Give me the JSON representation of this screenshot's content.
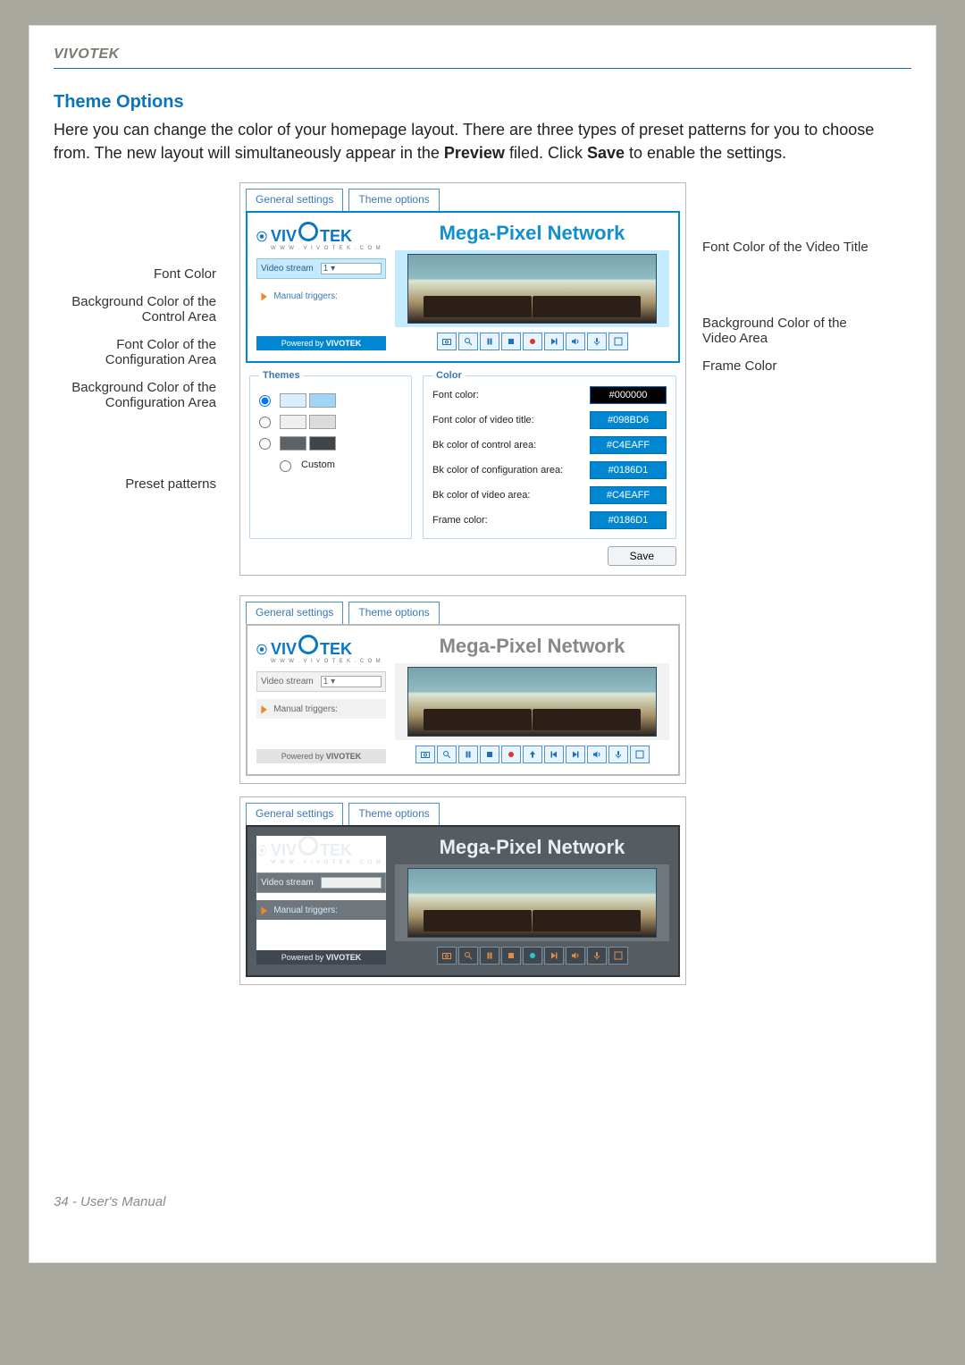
{
  "brand": "VIVOTEK",
  "section_title": "Theme Options",
  "intro_parts": {
    "a": "Here you can change the color of your homepage layout. There are three types of preset patterns for you to choose from. The new layout will simultaneously appear in the ",
    "b": "Preview",
    "c": " filed. Click ",
    "d": "Save",
    "e": " to enable the settings."
  },
  "callouts_left": [
    "Font Color",
    "Background Color of the Control Area",
    "Font Color of the Configuration Area",
    "Background Color of the Configuration Area",
    "Preset patterns"
  ],
  "callouts_right": [
    "Font Color of the Video Title",
    "Background Color of the Video Area",
    "Frame Color"
  ],
  "tabs": {
    "general": "General settings",
    "theme": "Theme options"
  },
  "preview": {
    "video_title": "Mega-Pixel Network",
    "video_stream_label": "Video stream",
    "video_stream_value": "1",
    "manual_triggers": "Manual triggers:",
    "powered_prefix": "Powered by ",
    "powered_brand": "VIVOTEK"
  },
  "control_icons": [
    "snapshot-icon",
    "zoom-icon",
    "pause-icon",
    "stop-icon",
    "record-icon",
    "step-fwd-icon",
    "volume-up-icon",
    "mic-icon",
    "fullscreen-icon"
  ],
  "control_icons_ext": [
    "snapshot-icon",
    "zoom-icon",
    "pause-icon",
    "stop-icon",
    "record-icon",
    "upload-icon",
    "skip-back-icon",
    "step-fwd-icon",
    "volume-up-icon",
    "mic-icon",
    "fullscreen-icon"
  ],
  "themes": {
    "legend": "Themes",
    "options": [
      "preset-blue",
      "preset-gray",
      "preset-dark"
    ],
    "custom_label": "Custom"
  },
  "colors": {
    "legend": "Color",
    "rows": [
      {
        "label": "Font color:",
        "value": "#000000",
        "swatch": "black"
      },
      {
        "label": "Font color of video title:",
        "value": "#098BD6",
        "swatch": "blue"
      },
      {
        "label": "Bk color of control area:",
        "value": "#C4EAFF",
        "swatch": "blue"
      },
      {
        "label": "Bk color of configuration area:",
        "value": "#0186D1",
        "swatch": "blue"
      },
      {
        "label": "Bk color of video area:",
        "value": "#C4EAFF",
        "swatch": "blue"
      },
      {
        "label": "Frame color:",
        "value": "#0186D1",
        "swatch": "blue"
      }
    ]
  },
  "save_label": "Save",
  "footer": "34 - User's Manual"
}
